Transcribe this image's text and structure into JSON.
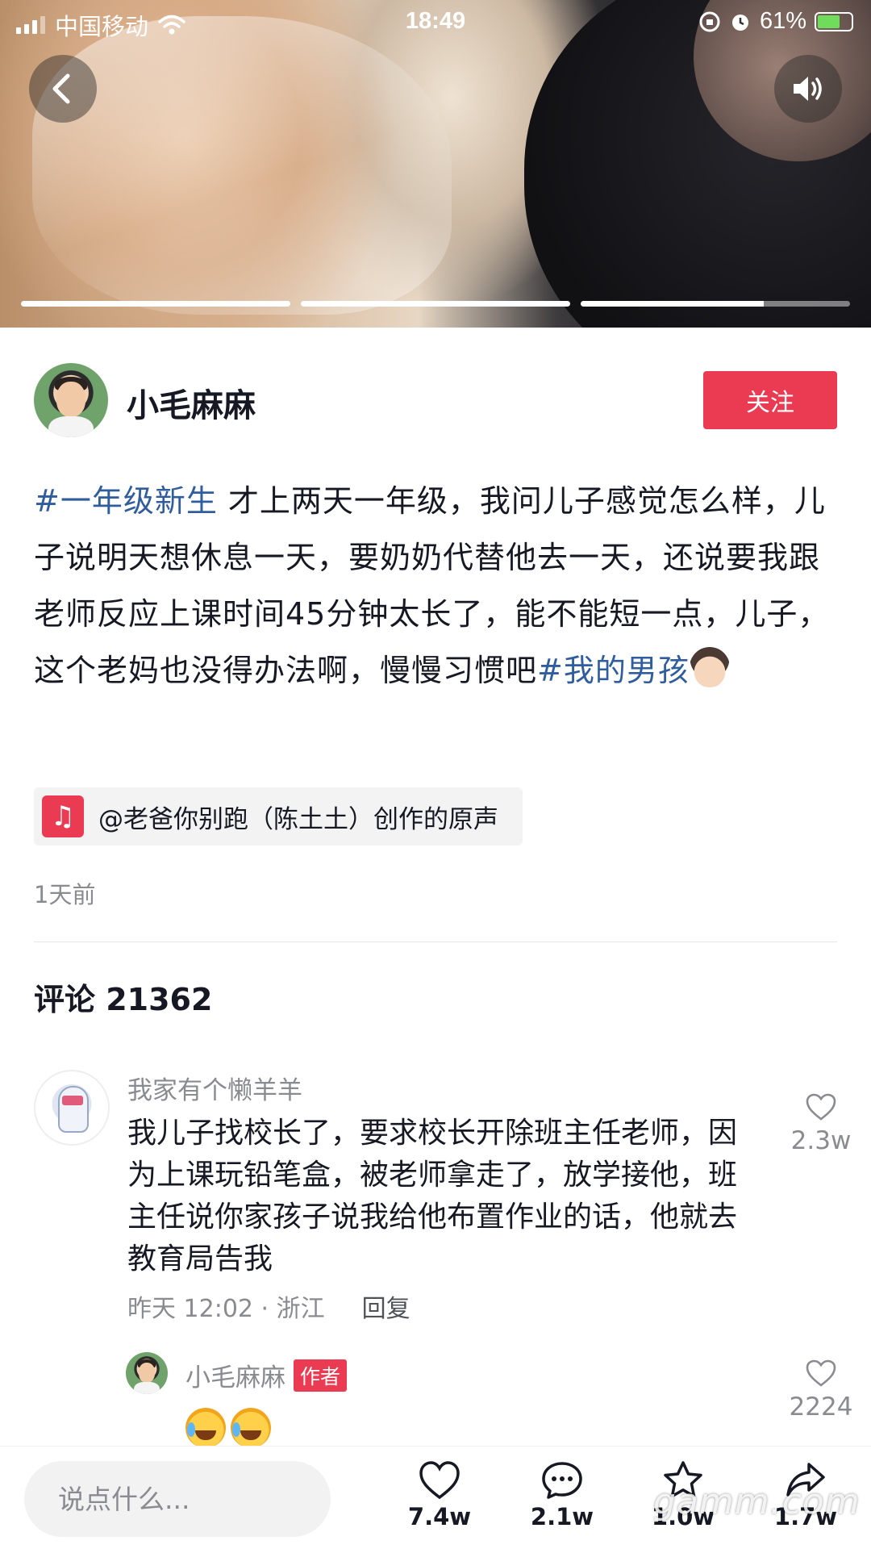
{
  "status_bar": {
    "carrier": "中国移动",
    "time": "18:49",
    "battery": "61%"
  },
  "media": {
    "segments": [
      {
        "progress": 1.0
      },
      {
        "progress": 1.0
      },
      {
        "progress": 0.68
      }
    ]
  },
  "author": {
    "name": "小毛麻麻",
    "follow_label": "关注"
  },
  "description": {
    "hashtag_1": "#一年级新生",
    "text": " 才上两天一年级，我问儿子感觉怎么样，儿子说明天想休息一天，要奶奶代替他去一天，还说要我跟老师反应上课时间45分钟太长了，能不能短一点，儿子，这个老妈也没得办法啊，慢慢习惯吧",
    "hashtag_2": "#我的男孩"
  },
  "music": {
    "label": "@老爸你别跑（陈土土）创作的原声"
  },
  "post_time": "1天前",
  "comments_section": {
    "title": "评论 21362"
  },
  "comments": [
    {
      "user": "我家有个懒羊羊",
      "text": "我儿子找校长了，要求校长开除班主任老师，因为上课玩铅笔盒，被老师拿走了，放学接他，班主任说你家孩子说我给他布置作业的话，他就去教育局告我",
      "time_location": "昨天 12:02 · 浙江",
      "reply_label": "回复",
      "likes": "2.3w"
    },
    {
      "user": "小毛麻麻",
      "badge": "作者",
      "likes": "2224"
    }
  ],
  "bottom_bar": {
    "input_placeholder": "说点什么...",
    "like_count": "7.4w",
    "comment_count": "2.1w",
    "favorite_count": "1.0w",
    "share_count": "1.7w"
  },
  "watermark": "gamm.com",
  "colors": {
    "accent_red": "#ea3b52",
    "hashtag_blue": "#2f5d9e",
    "text_primary": "#161823",
    "text_secondary": "#8a8b91"
  },
  "icons": [
    "back-arrow-icon",
    "speaker-icon",
    "music-note-icon",
    "heart-icon",
    "comment-bubble-icon",
    "star-icon",
    "share-arrow-icon",
    "laughing-emoji-icon",
    "boy-emoji-icon"
  ]
}
